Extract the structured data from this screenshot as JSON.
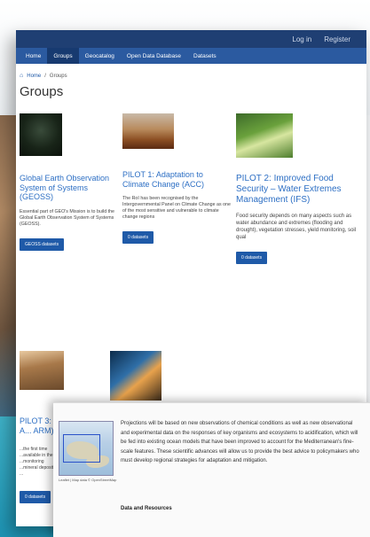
{
  "topbar": {
    "login": "Log in",
    "register": "Register"
  },
  "nav": {
    "items": [
      {
        "label": "Home",
        "active": false
      },
      {
        "label": "Groups",
        "active": true
      },
      {
        "label": "Geocatalog",
        "active": false
      },
      {
        "label": "Open Data Database",
        "active": false
      },
      {
        "label": "Datasets",
        "active": false
      }
    ]
  },
  "breadcrumb": {
    "home": "Home",
    "current": "Groups"
  },
  "page_title": "Groups",
  "groups": [
    {
      "title": "Global Earth Observation System of Systems (GEOSS)",
      "description": "Essential part of GEO's Mission is to build the Global Earth Observation System of Systems (GEOSS).",
      "button": "GEOSS datasets",
      "thumb": "geoss"
    },
    {
      "title": "PILOT 1: Adaptation to Climate Change (ACC)",
      "description": "The RoI has been recognised by the Intergovernmental Panel on Climate Change as one of the most sensitive and vulnerable to climate change regions",
      "button": "0 datasets",
      "thumb": "acc"
    },
    {
      "title": "PILOT 2: Improved Food Security – Water Extremes Management (IFS)",
      "description": "Food security depends on many aspects such as water abundance and extremes (flooding and drought), vegetation stresses, yield monitoring, soil qual",
      "button": "0 datasets",
      "thumb": "ifs"
    },
    {
      "title": "PILOT 3: A... ARM)",
      "description": "...the first time ...available in the ...monitoring ...mineral deposits ...",
      "button": "0 datasets",
      "thumb": "arm"
    },
    {
      "title": "",
      "description": "",
      "button": "",
      "thumb": "pilot4"
    }
  ],
  "overlay": {
    "text": "Projections will be based on new observations of chemical conditions as well as new observational and experimental data on the responses of key organisms and ecosystems to acidification, which will be fed into existing ocean models that have been improved to account for the Mediterranean's fine-scale features. These scientific advances will allow us to provide the best advice to policymakers who must develop regional strategies for adaptation and mitigation.",
    "heading": "Data and Resources",
    "map_caption": "Leaflet | Map data © OpenStreetMap"
  },
  "colors": {
    "topbar": "#1f3f73",
    "navbar": "#2b5aa0",
    "link": "#2d6fc4",
    "button": "#1f5aa8",
    "teal": "#1d93b3"
  }
}
